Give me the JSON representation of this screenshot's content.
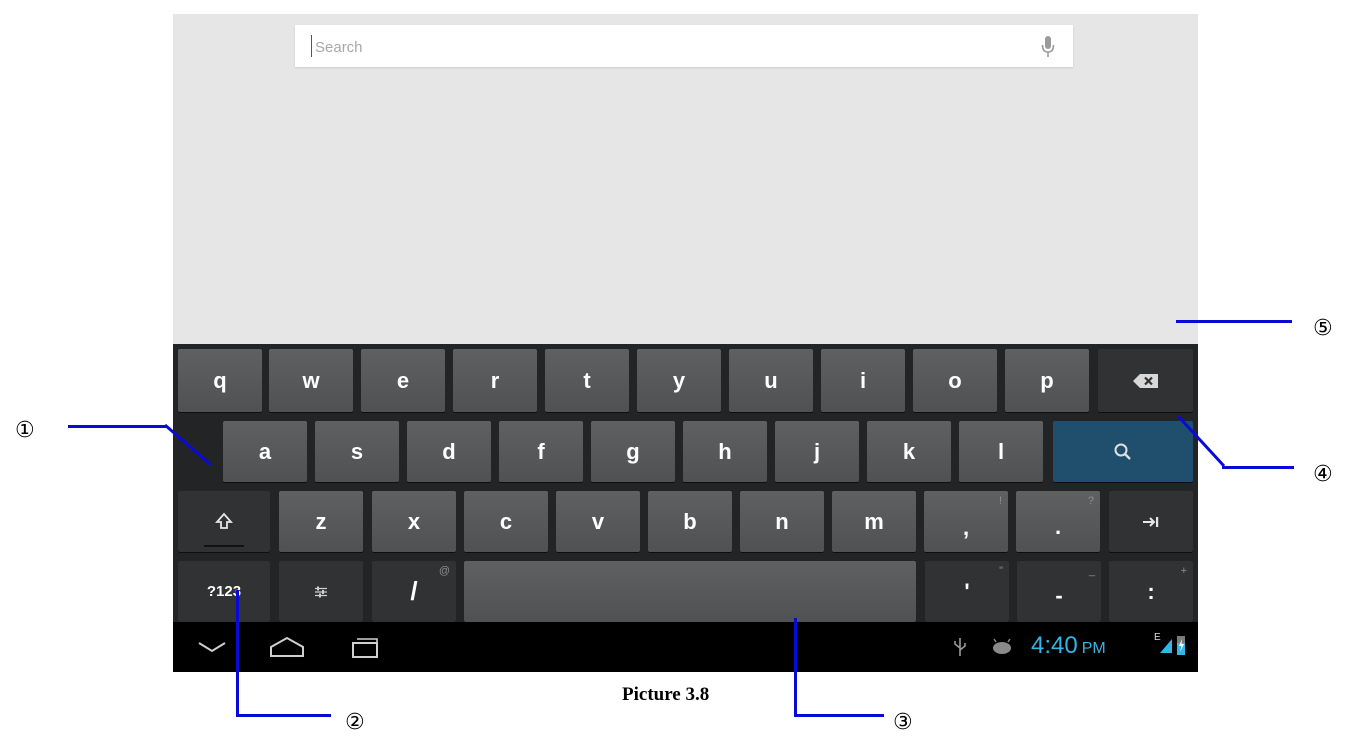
{
  "search": {
    "placeholder": "Search",
    "value": ""
  },
  "keyboard": {
    "row1": [
      "q",
      "w",
      "e",
      "r",
      "t",
      "y",
      "u",
      "i",
      "o",
      "p"
    ],
    "row2": [
      "a",
      "s",
      "d",
      "f",
      "g",
      "h",
      "j",
      "k",
      "l"
    ],
    "row3": [
      "z",
      "x",
      "c",
      "v",
      "b",
      "n",
      "m"
    ],
    "comma": ",",
    "comma_hint": "!",
    "period": ".",
    "period_hint": "?",
    "numbers_label": "?123",
    "slash": "/",
    "slash_hint": "@",
    "apostrophe": "'",
    "apostrophe_hint": "\"",
    "dash": "-",
    "dash_hint": "_",
    "colon": ":",
    "colon_hint": "+"
  },
  "status": {
    "time": "4:40",
    "ampm": "PM",
    "network": "E"
  },
  "callouts": {
    "c1": "①",
    "c2": "②",
    "c3": "③",
    "c4": "④",
    "c5": "⑤"
  },
  "caption": "Picture 3.8",
  "colors": {
    "accent": "#33b5e5",
    "search_key": "#1f4f6d",
    "callout": "#0a0ad6"
  }
}
